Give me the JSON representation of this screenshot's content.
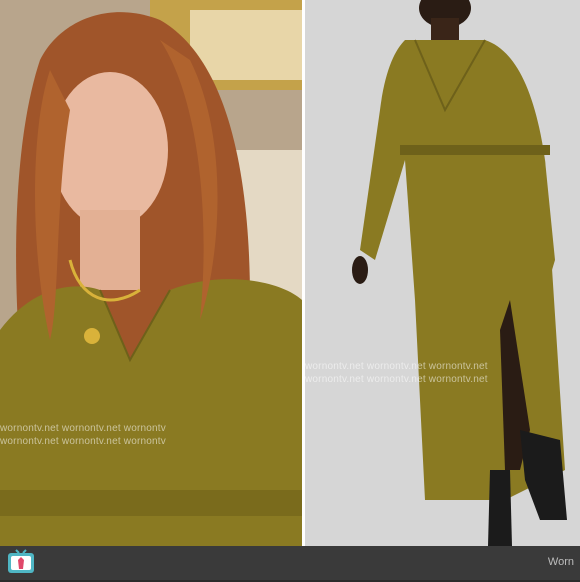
{
  "watermarks": {
    "left_row_1": "wornontv.net wornontv.net wornontv",
    "left_row_2": "wornontv.net wornontv.net wornontv",
    "right_row_1": "wornontv.net wornontv.net wornontv.net",
    "right_row_2": "wornontv.net wornontv.net wornontv.net"
  },
  "footer": {
    "brand_label": "Worn"
  },
  "colors": {
    "dress_satin": "#8a7a22",
    "hair": "#a0552a",
    "background_bar": "#3a3a3a",
    "logo_teal": "#4fb6c4",
    "logo_pink": "#e0486a"
  },
  "icons": {
    "logo": "tv-dress-logo"
  }
}
